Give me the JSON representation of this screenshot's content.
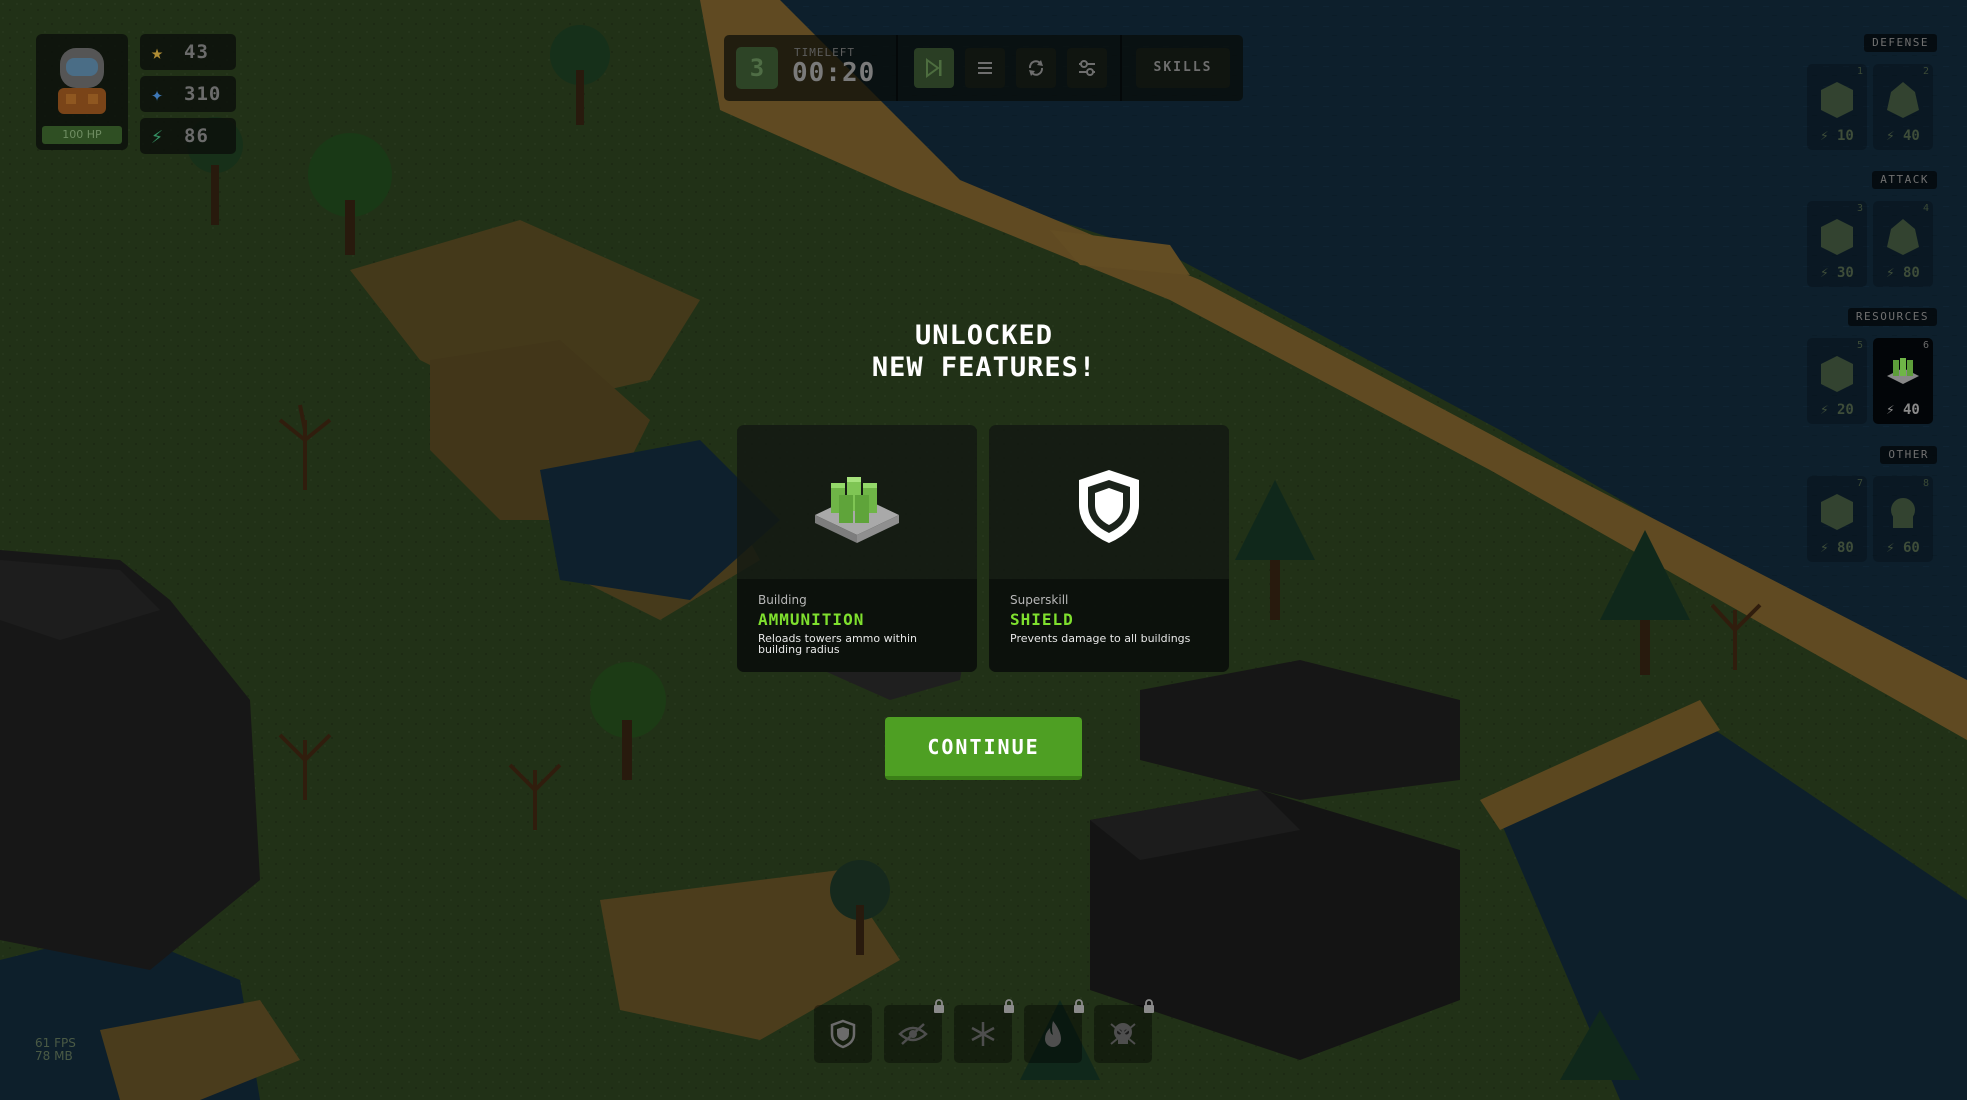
{
  "player": {
    "avatar_icon": "astronaut-icon",
    "hp_label": "100 HP",
    "stats": [
      {
        "name": "stars",
        "icon": "star-icon",
        "value": "43",
        "color": "#c8a23c"
      },
      {
        "name": "crystals",
        "icon": "crystal-icon",
        "value": "310",
        "color": "#4a8fd9"
      },
      {
        "name": "energy",
        "icon": "bolt-icon",
        "value": "86",
        "color": "#41b07a"
      }
    ]
  },
  "toolbar": {
    "wave_number": "3",
    "time_left_label": "TIMELEFT",
    "time_left_value": "00:20",
    "skills_label": "SKILLS",
    "icons": [
      "play-next-icon",
      "list-icon",
      "refresh-icon",
      "settings-sliders-icon"
    ]
  },
  "build_panel": {
    "categories": [
      {
        "label": "DEFENSE",
        "slots": [
          {
            "number": "1",
            "cost": "10"
          },
          {
            "number": "2",
            "cost": "40"
          }
        ]
      },
      {
        "label": "ATTACK",
        "slots": [
          {
            "number": "3",
            "cost": "30"
          },
          {
            "number": "4",
            "cost": "80"
          }
        ]
      },
      {
        "label": "RESOURCES",
        "slots": [
          {
            "number": "5",
            "cost": "20"
          },
          {
            "number": "6",
            "cost": "40",
            "active": true
          }
        ]
      },
      {
        "label": "OTHER",
        "slots": [
          {
            "number": "7",
            "cost": "80"
          },
          {
            "number": "8",
            "cost": "60"
          }
        ]
      }
    ]
  },
  "modal": {
    "title_line1": "UNLOCKED",
    "title_line2": "NEW FEATURES!",
    "cards": [
      {
        "category": "Building",
        "name": "AMMUNITION",
        "description": "Reloads towers ammo within building radius",
        "icon": "ammunition-building-icon"
      },
      {
        "category": "Superskill",
        "name": "SHIELD",
        "description": "Prevents damage to all buildings",
        "icon": "shield-icon"
      }
    ],
    "continue_label": "CONTINUE"
  },
  "skills_bar": [
    {
      "icon": "shield-icon",
      "locked": false
    },
    {
      "icon": "eye-off-icon",
      "locked": true
    },
    {
      "icon": "snowflake-icon",
      "locked": true
    },
    {
      "icon": "fire-icon",
      "locked": true
    },
    {
      "icon": "skull-icon",
      "locked": true
    }
  ],
  "debug": {
    "fps": "61 FPS",
    "memory": "78 MB"
  },
  "colors": {
    "accent_green": "#7fe02e",
    "button_green": "#4e9f23",
    "water": "#163248",
    "grass": "#3d5a2a",
    "sand": "#b58a3c",
    "rock": "#2a2a2a"
  }
}
